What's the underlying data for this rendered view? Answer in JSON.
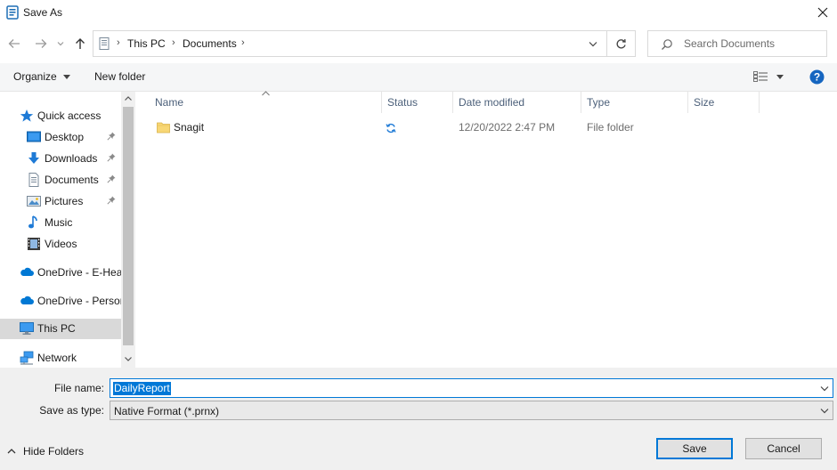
{
  "window": {
    "title": "Save As",
    "close_icon": "close-icon"
  },
  "nav": {
    "back_icon": "back-arrow-icon",
    "forward_icon": "forward-arrow-icon",
    "recent_icon": "chevron-down-icon",
    "up_icon": "up-arrow-icon"
  },
  "address": {
    "crumbs": [
      "This PC",
      "Documents"
    ],
    "dropdown_icon": "chevron-down-icon",
    "refresh_icon": "refresh-icon"
  },
  "search": {
    "placeholder": "Search Documents",
    "icon": "search-icon"
  },
  "toolbar": {
    "organize_label": "Organize",
    "new_folder_label": "New folder",
    "view_icon": "view-details-icon",
    "help_icon": "help-icon"
  },
  "sidebar": {
    "items": [
      {
        "label": "Quick access",
        "icon": "star-icon",
        "pinned": false
      },
      {
        "label": "Desktop",
        "icon": "desktop-icon",
        "pinned": true
      },
      {
        "label": "Downloads",
        "icon": "download-icon",
        "pinned": true
      },
      {
        "label": "Documents",
        "icon": "document-icon",
        "pinned": true
      },
      {
        "label": "Pictures",
        "icon": "pictures-icon",
        "pinned": true
      },
      {
        "label": "Music",
        "icon": "music-icon",
        "pinned": false
      },
      {
        "label": "Videos",
        "icon": "video-icon",
        "pinned": false
      },
      {
        "label": "OneDrive - E-Heal",
        "icon": "cloud-icon",
        "pinned": false
      },
      {
        "label": "OneDrive - Persor",
        "icon": "cloud-icon",
        "pinned": false
      },
      {
        "label": "This PC",
        "icon": "computer-icon",
        "pinned": false,
        "selected": true
      },
      {
        "label": "Network",
        "icon": "network-icon",
        "pinned": false
      }
    ]
  },
  "filelist": {
    "columns": [
      "Name",
      "Status",
      "Date modified",
      "Type",
      "Size"
    ],
    "rows": [
      {
        "name": "Snagit",
        "status_icon": "sync-icon",
        "date": "12/20/2022 2:47 PM",
        "type": "File folder",
        "size": ""
      }
    ]
  },
  "form": {
    "file_name_label": "File name:",
    "file_name_value": "DailyReport",
    "save_type_label": "Save as type:",
    "save_type_value": "Native Format (*.prnx)"
  },
  "buttons": {
    "save": "Save",
    "cancel": "Cancel",
    "hide_folders": "Hide Folders"
  },
  "colors": {
    "accent": "#0078d7",
    "selection": "#d9d9d9",
    "folder": "#f8d775",
    "cloud": "#0078d4"
  }
}
